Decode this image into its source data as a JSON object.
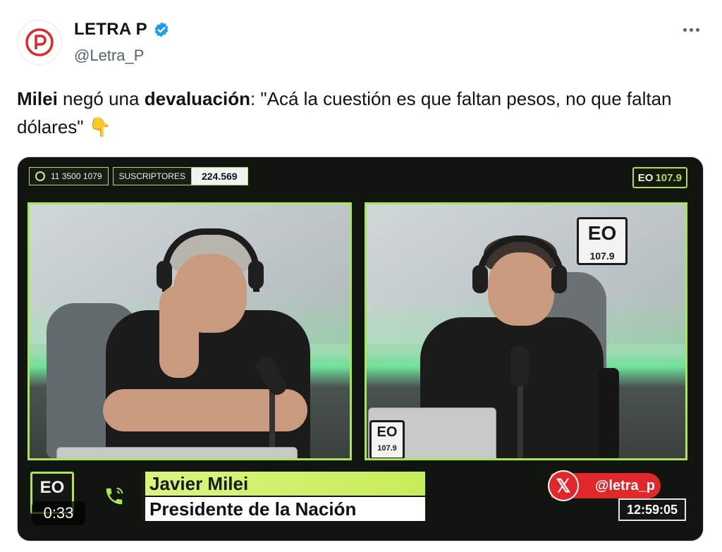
{
  "author": {
    "display_name": "LETRA P",
    "handle": "@Letra_P",
    "verified": true
  },
  "tweet": {
    "part1_bold": "Milei",
    "part2": " negó una ",
    "part3_bold": "devaluación",
    "part4": ": \"Acá la cuestión es que faltan pesos, no que faltan dólares\" ",
    "emoji": "👇"
  },
  "video": {
    "phone_label": "11 3500 1079",
    "subs_label": "SUSCRIPTORES",
    "subs_value": "224.569",
    "station_logo_left": "EO",
    "station_logo_num": "107.9",
    "studio_sign_top": "EO",
    "studio_sign_num": "107.9",
    "lower_logo": "EO",
    "guest_name": "Javier Milei",
    "guest_title": "Presidente de la Nación",
    "brand_handle": "@letra_p",
    "clock": "12:59:05",
    "elapsed": "0:33"
  },
  "colors": {
    "accent_green": "#a6e84d",
    "brand_red": "#e2272b",
    "verified_blue": "#1d9bf0"
  },
  "icons": [
    "more-icon",
    "verified-icon",
    "whatsapp-icon",
    "phone-icon",
    "x-logo-icon",
    "letra-p-logo-icon"
  ]
}
